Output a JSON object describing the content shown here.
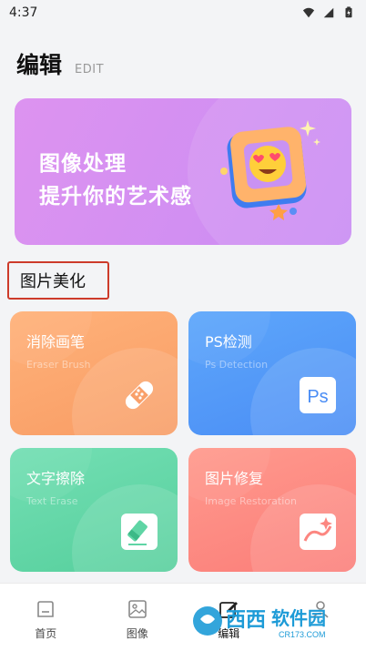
{
  "status": {
    "time": "4:37"
  },
  "header": {
    "title": "编辑",
    "subtitle": "EDIT"
  },
  "banner": {
    "line1": "图像处理",
    "line2": "提升你的艺术感"
  },
  "section": {
    "title": "图片美化"
  },
  "cards": [
    {
      "title": "消除画笔",
      "subtitle": "Eraser Brush",
      "icon": "bandage-icon"
    },
    {
      "title": "PS检测",
      "subtitle": "Ps Detection",
      "icon": "ps-icon",
      "icon_text": "Ps"
    },
    {
      "title": "文字擦除",
      "subtitle": "Text Erase",
      "icon": "eraser-icon"
    },
    {
      "title": "图片修复",
      "subtitle": "Image Restoration",
      "icon": "image-repair-icon"
    }
  ],
  "nav": [
    {
      "label": "首页",
      "icon": "home-icon"
    },
    {
      "label": "图像",
      "icon": "image-icon"
    },
    {
      "label": "编辑",
      "icon": "edit-icon"
    },
    {
      "label": "",
      "icon": "profile-icon"
    }
  ],
  "watermark": {
    "brand": "西西",
    "text": "软件园",
    "url": "CR173.COM"
  },
  "colors": {
    "banner": "#d28ef1",
    "card_eraser": "#f9a06a",
    "card_ps": "#5198f7",
    "card_text_erase": "#5fd5a5",
    "card_repair": "#fc8680",
    "section_border": "#cd3b2a"
  }
}
